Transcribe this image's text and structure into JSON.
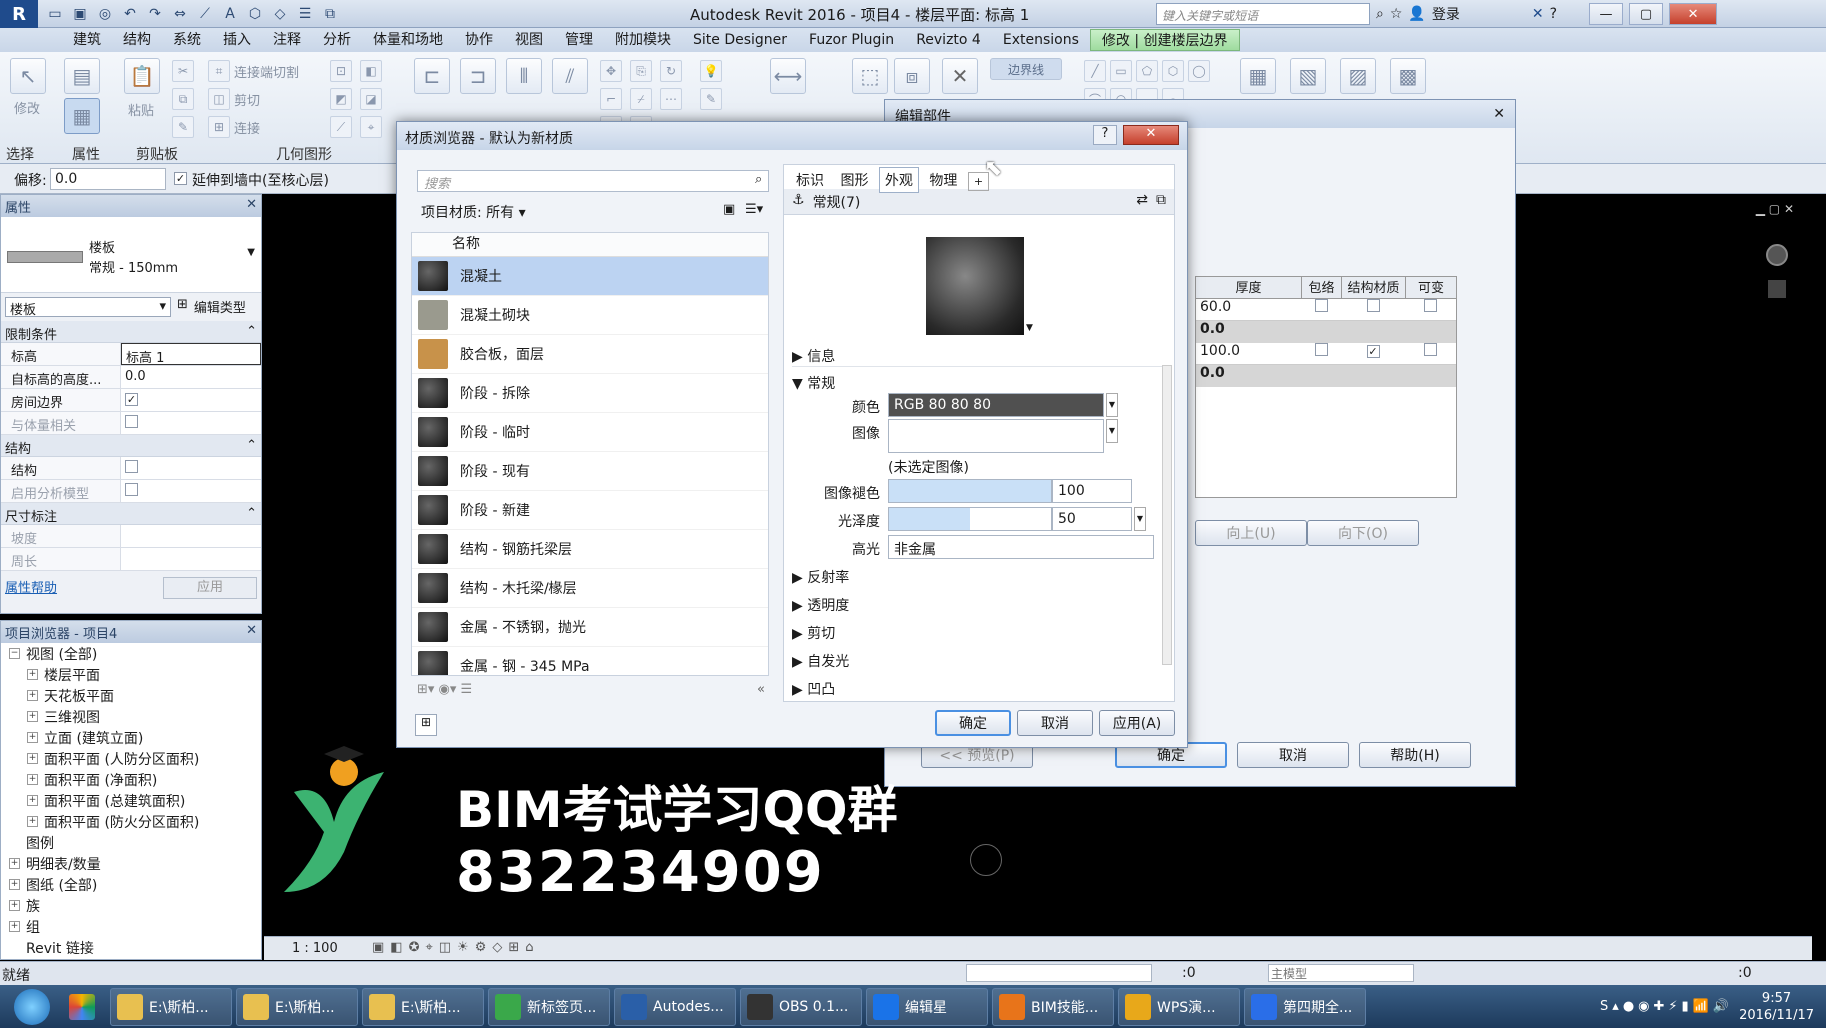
{
  "app": {
    "title": "Autodesk Revit 2016 -    项目4 - 楼层平面: 标高 1",
    "search_placeholder": "键入关键字或短语",
    "login": "登录"
  },
  "tabs": [
    "建筑",
    "结构",
    "系统",
    "插入",
    "注释",
    "分析",
    "体量和场地",
    "协作",
    "视图",
    "管理",
    "附加模块",
    "Site Designer",
    "Fuzor Plugin",
    "Revizto 4",
    "Extensions",
    "修改 | 创建楼层边界"
  ],
  "ribbon": {
    "modify": "修改",
    "paste": "粘贴",
    "cut": "剪切",
    "join": "连接",
    "connect_cut": "连接端切割",
    "select_label": "选择",
    "props_label": "属性",
    "clipboard_label": "剪贴板",
    "geometry_label": "几何图形",
    "boundary_line": "边界线"
  },
  "optbar": {
    "offset_label": "偏移:",
    "offset_value": "0.0",
    "extend_label": "延伸到墙中(至核心层)"
  },
  "props": {
    "title": "属性",
    "type_name": "楼板",
    "type_sub": "常规 - 150mm",
    "category": "楼板",
    "edit_type": "编辑类型",
    "sections": [
      {
        "name": "限制条件",
        "rows": [
          {
            "k": "标高",
            "v": "标高 1"
          },
          {
            "k": "自标高的高度...",
            "v": "0.0"
          },
          {
            "k": "房间边界",
            "v": "✓"
          },
          {
            "k": "与体量相关",
            "v": "",
            "dim": true
          }
        ]
      },
      {
        "name": "结构",
        "rows": [
          {
            "k": "结构",
            "v": ""
          },
          {
            "k": "启用分析模型",
            "v": "",
            "dim": true
          }
        ]
      },
      {
        "name": "尺寸标注",
        "rows": [
          {
            "k": "坡度",
            "v": "",
            "dim": true
          },
          {
            "k": "周长",
            "v": "",
            "dim": true
          }
        ]
      }
    ],
    "help": "属性帮助",
    "apply": "应用"
  },
  "browser": {
    "title": "项目浏览器 - 项目4",
    "items": [
      {
        "t": "视图 (全部)",
        "lvl": 0,
        "ex": "−"
      },
      {
        "t": "楼层平面",
        "lvl": 1,
        "ex": "+"
      },
      {
        "t": "天花板平面",
        "lvl": 1,
        "ex": "+"
      },
      {
        "t": "三维视图",
        "lvl": 1,
        "ex": "+"
      },
      {
        "t": "立面 (建筑立面)",
        "lvl": 1,
        "ex": "+"
      },
      {
        "t": "面积平面 (人防分区面积)",
        "lvl": 1,
        "ex": "+"
      },
      {
        "t": "面积平面 (净面积)",
        "lvl": 1,
        "ex": "+"
      },
      {
        "t": "面积平面 (总建筑面积)",
        "lvl": 1,
        "ex": "+"
      },
      {
        "t": "面积平面 (防火分区面积)",
        "lvl": 1,
        "ex": "+"
      },
      {
        "t": "图例",
        "lvl": 0,
        "ex": ""
      },
      {
        "t": "明细表/数量",
        "lvl": 0,
        "ex": "+"
      },
      {
        "t": "图纸 (全部)",
        "lvl": 0,
        "ex": "+"
      },
      {
        "t": "族",
        "lvl": 0,
        "ex": "+"
      },
      {
        "t": "组",
        "lvl": 0,
        "ex": "+"
      },
      {
        "t": "Revit 链接",
        "lvl": 0,
        "ex": ""
      }
    ]
  },
  "matdlg": {
    "title": "材质浏览器 - 默认为新材质",
    "search_placeholder": "搜索",
    "filter": "项目材质: 所有",
    "col_name": "名称",
    "materials": [
      "混凝土",
      "混凝土砌块",
      "胶合板，面层",
      "阶段 - 拆除",
      "阶段 - 临时",
      "阶段 - 现有",
      "阶段 - 新建",
      "结构 - 钢筋托梁层",
      "结构 - 木托梁/椽层",
      "金属 - 不锈钢，抛光",
      "金属 - 钢 - 345 MPa"
    ],
    "asset_tabs": [
      "标识",
      "图形",
      "外观",
      "物理"
    ],
    "asset_name": "常规(7)",
    "sec_info": "信息",
    "sec_general": "常规",
    "color_label": "颜色",
    "color_value": "RGB 80 80 80",
    "image_label": "图像",
    "no_image": "(未选定图像)",
    "fade_label": "图像褪色",
    "fade_value": "100",
    "gloss_label": "光泽度",
    "gloss_value": "50",
    "highlight_label": "高光",
    "highlight_value": "非金属",
    "more": [
      "反射率",
      "透明度",
      "剪切",
      "自发光",
      "凹凸"
    ],
    "ok": "确定",
    "cancel": "取消",
    "apply": "应用(A)"
  },
  "editdlg": {
    "title": "编辑部件",
    "cols": [
      "厚度",
      "包络",
      "结构材质",
      "可变"
    ],
    "rows": [
      {
        "t": "60.0",
        "s": false
      },
      {
        "t": "0.0",
        "bold": true
      },
      {
        "t": "100.0",
        "s": true
      },
      {
        "t": "0.0",
        "bold": true
      }
    ],
    "up": "向上(U)",
    "down": "向下(O)",
    "preview": "<< 预览(P)",
    "ok": "确定",
    "cancel": "取消",
    "help": "帮助(H)"
  },
  "viewbar": {
    "scale": "1 : 100"
  },
  "status": {
    "text": "就绪",
    "coord": ":0",
    "model": "主模型",
    "filter": ":0"
  },
  "watermark": {
    "line1": "BIM考试学习QQ群",
    "line2": "832234909"
  },
  "taskbar": {
    "items": [
      "E:\\斯柏...",
      "E:\\斯柏...",
      "E:\\斯柏...",
      "新标签页...",
      "Autodes...",
      "OBS 0.1...",
      "编辑星",
      "BIM技能...",
      "WPS演...",
      "第四期全..."
    ],
    "time": "9:57",
    "date": "2016/11/17"
  }
}
